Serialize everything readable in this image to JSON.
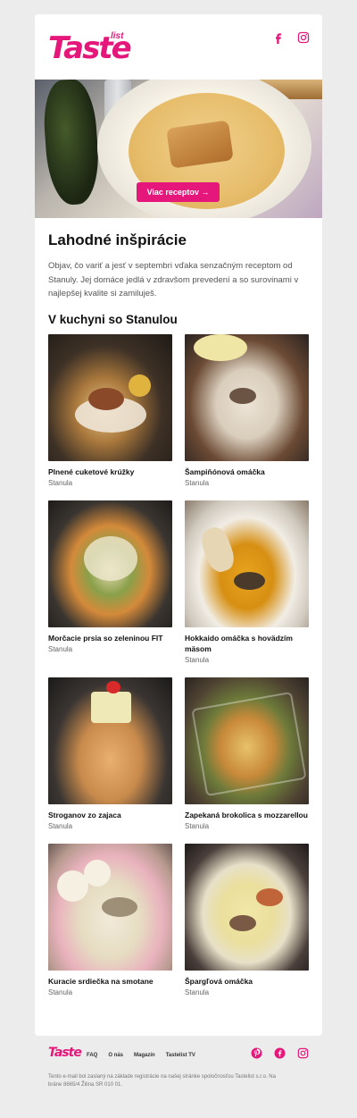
{
  "brand": {
    "logo_text": "Taste",
    "logo_sub": "list",
    "accent": "#e5177b"
  },
  "header": {
    "icons": [
      "facebook-icon",
      "instagram-icon"
    ]
  },
  "hero": {
    "button_label": "Viac receptov →"
  },
  "main": {
    "title": "Lahodné inšpirácie",
    "intro": "Objav, čo variť a jesť v septembri vďaka senzačným receptom od Stanuly. Jej domáce jedlá v zdravšom prevedení a so surovinami v najlepšej kvalite si zamiluješ.",
    "section_title": "V kuchyni so Stanulou"
  },
  "recipes": [
    {
      "title": "Plnené cuketové krúžky",
      "author": "Stanula"
    },
    {
      "title": "Šampiňónová omáčka",
      "author": "Stanula"
    },
    {
      "title": "Morčacie prsia so zeleninou FIT",
      "author": "Stanula"
    },
    {
      "title": "Hokkaido omáčka s hovädzím mäsom",
      "author": "Stanula"
    },
    {
      "title": "Stroganov zo zajaca",
      "author": "Stanula"
    },
    {
      "title": "Zapekaná brokolica s mozzarellou",
      "author": "Stanula"
    },
    {
      "title": "Kuracie srdiečka na smotane",
      "author": "Stanula"
    },
    {
      "title": "Špargľová omáčka",
      "author": "Stanula"
    }
  ],
  "footer": {
    "logo_text": "Taste",
    "links": [
      "FAQ",
      "O nás",
      "Magazín",
      "Tastelist TV"
    ],
    "icons": [
      "pinterest-icon",
      "facebook-icon",
      "instagram-icon"
    ],
    "legal": "Tento e-mail bol zaslaný na základe registrácie na našej stránke spoločnosťou Tastelist s.r.o. Na bráne 8665/4 Žilina SR 010 01."
  }
}
